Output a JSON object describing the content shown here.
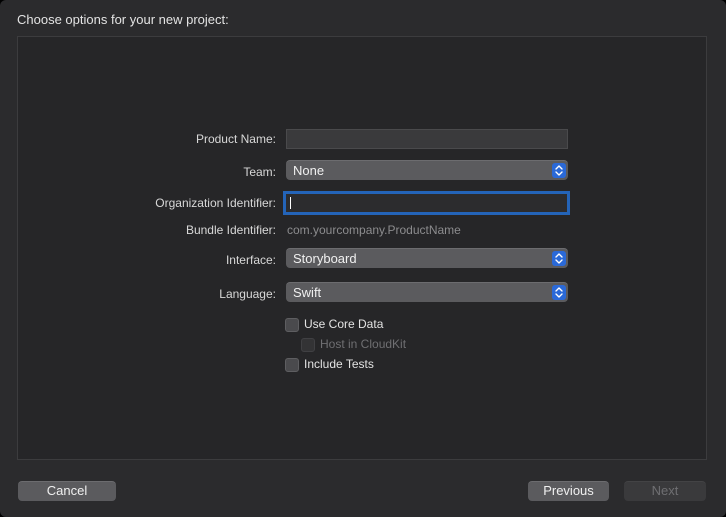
{
  "header": {
    "title": "Choose options for your new project:"
  },
  "form": {
    "product_name": {
      "label": "Product Name:",
      "value": ""
    },
    "team": {
      "label": "Team:",
      "selected": "None"
    },
    "organization_identifier": {
      "label": "Organization Identifier:",
      "value": ""
    },
    "bundle_identifier": {
      "label": "Bundle Identifier:",
      "value": "com.yourcompany.ProductName"
    },
    "interface": {
      "label": "Interface:",
      "selected": "Storyboard"
    },
    "language": {
      "label": "Language:",
      "selected": "Swift"
    },
    "options": {
      "use_core_data": {
        "label": "Use Core Data",
        "checked": false
      },
      "host_in_cloudkit": {
        "label": "Host in CloudKit",
        "checked": false,
        "disabled": true
      },
      "include_tests": {
        "label": "Include Tests",
        "checked": false
      }
    }
  },
  "footer": {
    "cancel_label": "Cancel",
    "previous_label": "Previous",
    "next_label": "Next"
  },
  "colors": {
    "accent": "#2a69d8",
    "focus_ring": "#2464b8",
    "background": "#2b2b2d",
    "panel": "#262628"
  }
}
